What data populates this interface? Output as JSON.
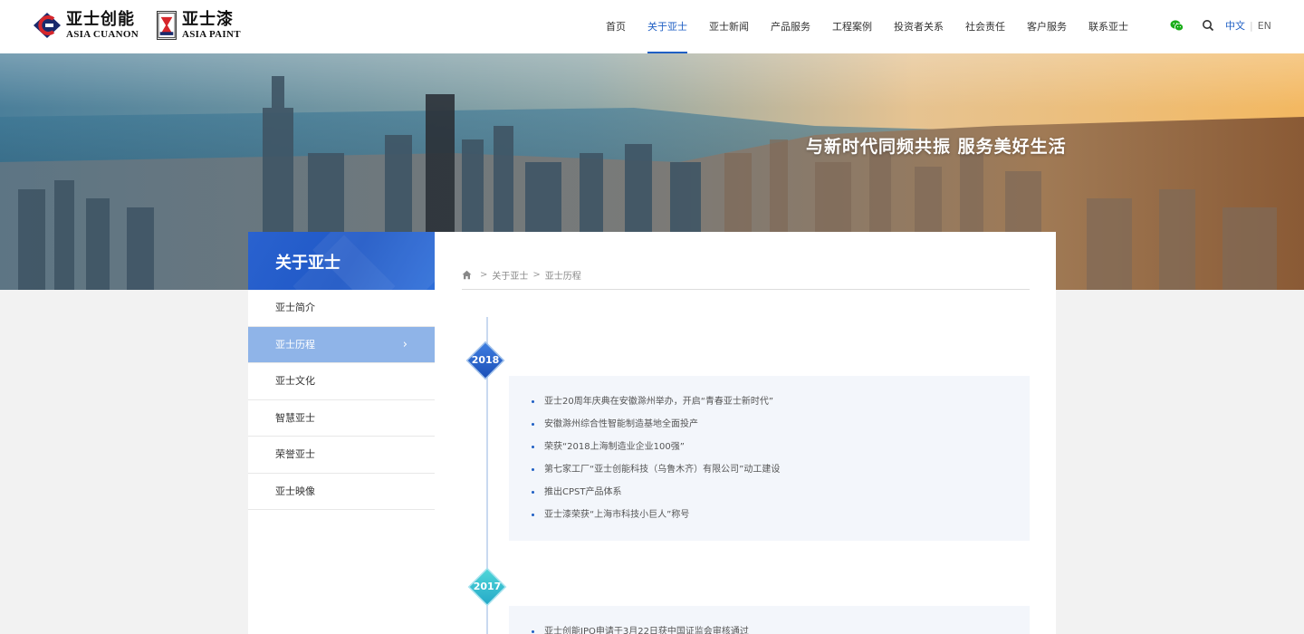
{
  "header": {
    "logos": [
      {
        "cn": "亚士创能",
        "en": "ASIA CUANON"
      },
      {
        "cn": "亚士漆",
        "en": "ASIA PAINT"
      }
    ],
    "nav": [
      {
        "label": "首页",
        "active": false
      },
      {
        "label": "关于亚士",
        "active": true
      },
      {
        "label": "亚士新闻",
        "active": false
      },
      {
        "label": "产品服务",
        "active": false
      },
      {
        "label": "工程案例",
        "active": false
      },
      {
        "label": "投资者关系",
        "active": false
      },
      {
        "label": "社会责任",
        "active": false
      },
      {
        "label": "客户服务",
        "active": false
      },
      {
        "label": "联系亚士",
        "active": false
      }
    ],
    "tools": {
      "wechat_icon": "wechat-icon",
      "search_icon": "search-icon"
    },
    "lang": {
      "current": "中文",
      "other": "EN"
    }
  },
  "banner": {
    "slogan": "与新时代同频共振 服务美好生活"
  },
  "sidebar": {
    "title": "关于亚士",
    "items": [
      {
        "label": "亚士简介",
        "active": false
      },
      {
        "label": "亚士历程",
        "active": true
      },
      {
        "label": "亚士文化",
        "active": false
      },
      {
        "label": "智慧亚士",
        "active": false
      },
      {
        "label": "荣誉亚士",
        "active": false
      },
      {
        "label": "亚士映像",
        "active": false
      }
    ],
    "chevron": "›"
  },
  "breadcrumb": {
    "home_icon": "home-icon",
    "sep": ">",
    "items": [
      "关于亚士",
      "亚士历程"
    ]
  },
  "timeline": [
    {
      "year": "2018",
      "events": [
        "亚士20周年庆典在安徽滁州举办，开启“青春亚士新时代”",
        "安徽滁州综合性智能制造基地全面投产",
        "荣获“2018上海制造业企业100强”",
        "第七家工厂“亚士创能科技（乌鲁木齐）有限公司”动工建设",
        "推出CPST产品体系",
        "亚士漆荣获“上海市科技小巨人”称号"
      ]
    },
    {
      "year": "2017",
      "events": [
        "亚士创能IPO申请于3月22日获中国证监会审核通过"
      ]
    }
  ],
  "colors": {
    "brand_blue": "#1f5fc4",
    "sidebar_active": "#8fb4e8",
    "events_bg": "#f3f6fb"
  }
}
